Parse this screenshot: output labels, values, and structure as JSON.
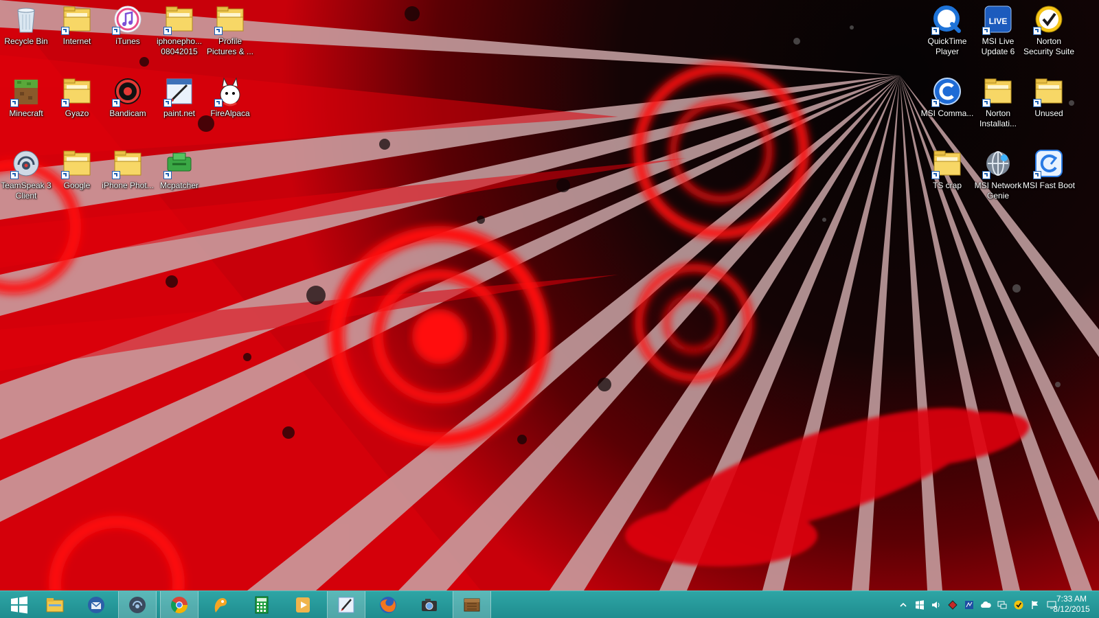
{
  "desktop": {
    "left_icons": [
      {
        "label": "Recycle Bin",
        "icon": "recycle-bin-icon"
      },
      {
        "label": "Internet",
        "icon": "folder-icon"
      },
      {
        "label": "iTunes",
        "icon": "itunes-icon"
      },
      {
        "label": "iphonepho... 08042015",
        "icon": "folder-icon"
      },
      {
        "label": "Profile Pictures & ...",
        "icon": "folder-icon"
      },
      {
        "label": "Minecraft",
        "icon": "minecraft-icon"
      },
      {
        "label": "Gyazo",
        "icon": "folder-icon"
      },
      {
        "label": "Bandicam",
        "icon": "bandicam-icon"
      },
      {
        "label": "paint.net",
        "icon": "paintnet-icon"
      },
      {
        "label": "FireAlpaca",
        "icon": "firealpaca-icon"
      },
      {
        "label": "TeamSpeak 3 Client",
        "icon": "teamspeak-icon"
      },
      {
        "label": "Google",
        "icon": "folder-icon"
      },
      {
        "label": "iPhone Phot...",
        "icon": "folder-icon"
      },
      {
        "label": "Mcpatcher",
        "icon": "mcpatcher-icon"
      }
    ],
    "right_icons": [
      {
        "label": "QuickTime Player",
        "icon": "quicktime-icon"
      },
      {
        "label": "MSI Live Update 6",
        "icon": "msi-live-update-icon"
      },
      {
        "label": "Norton Security Suite",
        "icon": "norton-icon"
      },
      {
        "label": "MSI Comma...",
        "icon": "msi-command-icon"
      },
      {
        "label": "Norton Installati...",
        "icon": "folder-icon"
      },
      {
        "label": "Unused",
        "icon": "folder-icon"
      },
      {
        "label": "TS crap",
        "icon": "folder-icon"
      },
      {
        "label": "MSI Network Genie",
        "icon": "network-genie-icon"
      },
      {
        "label": "MSI Fast Boot",
        "icon": "fast-boot-icon"
      }
    ]
  },
  "taskbar": {
    "items": [
      {
        "name": "start-button",
        "icon": "windows-logo-icon"
      },
      {
        "name": "taskbar-file-explorer",
        "icon": "file-explorer-icon"
      },
      {
        "name": "taskbar-thunderbird",
        "icon": "thunderbird-icon"
      },
      {
        "name": "taskbar-teamspeak",
        "icon": "teamspeak-icon"
      },
      {
        "name": "taskbar-chrome",
        "icon": "chrome-icon"
      },
      {
        "name": "taskbar-gyazo",
        "icon": "gyazo-icon"
      },
      {
        "name": "taskbar-calculator",
        "icon": "calculator-icon"
      },
      {
        "name": "taskbar-media-player",
        "icon": "media-player-icon"
      },
      {
        "name": "taskbar-paintnet",
        "icon": "paintnet-icon"
      },
      {
        "name": "taskbar-firefox",
        "icon": "firefox-icon"
      },
      {
        "name": "taskbar-bandicam",
        "icon": "camera-icon"
      },
      {
        "name": "taskbar-minecraft",
        "icon": "minecraft-icon"
      }
    ],
    "active_items": [
      "taskbar-teamspeak",
      "taskbar-chrome",
      "taskbar-paintnet",
      "taskbar-minecraft"
    ],
    "tray": [
      "show-hidden-icons-icon",
      "windows-flag-icon",
      "volume-icon",
      "norton-tray-icon",
      "msi-tray-icon",
      "onedrive-icon",
      "network-tray-icon",
      "norton-check-icon",
      "action-center-flag-icon",
      "display-icon"
    ],
    "clock": {
      "time": "7:33 AM",
      "date": "8/12/2015"
    }
  },
  "colors": {
    "taskbar": "#1f8d8f",
    "wallpaper_red": "#d8000a",
    "wallpaper_dark": "#0b0506"
  }
}
